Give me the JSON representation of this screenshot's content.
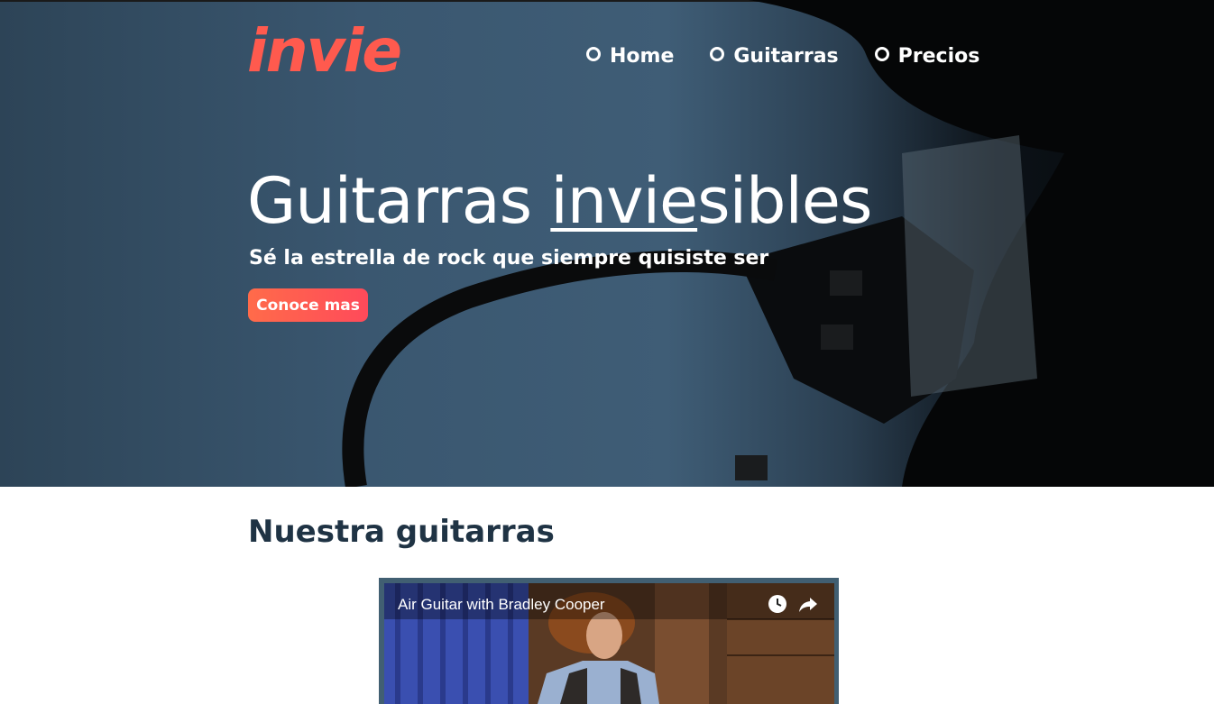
{
  "header": {
    "logo": "invie",
    "nav": [
      {
        "label": "Home"
      },
      {
        "label": "Guitarras"
      },
      {
        "label": "Precios"
      }
    ]
  },
  "hero": {
    "title_before": "Guitarras ",
    "title_underlined": "invie",
    "title_after": "sibles",
    "subtitle": "Sé la estrella de rock que siempre quisiste ser",
    "cta_label": "Conoce mas"
  },
  "section": {
    "title": "Nuestra guitarras"
  },
  "video": {
    "title": "Air Guitar with Bradley Cooper",
    "icons": [
      "watch-later-icon",
      "share-icon"
    ]
  },
  "colors": {
    "brand": "#ff5a4e",
    "hero_bg": "#3a5770",
    "section_text": "#1f3344",
    "video_frame": "#415f72"
  }
}
